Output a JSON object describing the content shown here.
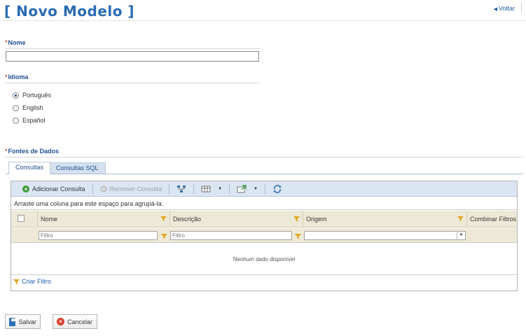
{
  "header": {
    "title": "[ Novo Modelo ]",
    "back_label": "Voltar"
  },
  "nome": {
    "label": "Nome",
    "required_mark": "*",
    "value": ""
  },
  "idioma": {
    "label": "Idioma",
    "required_mark": "*",
    "options": [
      "Português",
      "English",
      "Español"
    ],
    "selected": "Português"
  },
  "fontes": {
    "label": "Fontes de Dados",
    "required_mark": "*",
    "tabs": [
      {
        "label": "Consultas",
        "active": true
      },
      {
        "label": "Consultas SQL",
        "active": false
      }
    ],
    "toolbar": {
      "add_label": "Adicionar Consulta",
      "remove_label": "Remover Consulta"
    },
    "group_hint": "Arraste uma coluna para este espaço para agrupá-la.",
    "columns": [
      "Nome",
      "Descrição",
      "Origem",
      "Combinar Filtros"
    ],
    "filter_placeholder": "Filtro",
    "empty_message": "Nenhum dado disponível",
    "create_filter_label": "Criar Filtro"
  },
  "actions": {
    "save_label": "Salvar",
    "cancel_label": "Cancelar"
  },
  "colors": {
    "title": "#2a6cb3",
    "header_bg": "#eee9d7",
    "toolbar_bg": "#dbe6f3",
    "required": "#cc0000"
  }
}
